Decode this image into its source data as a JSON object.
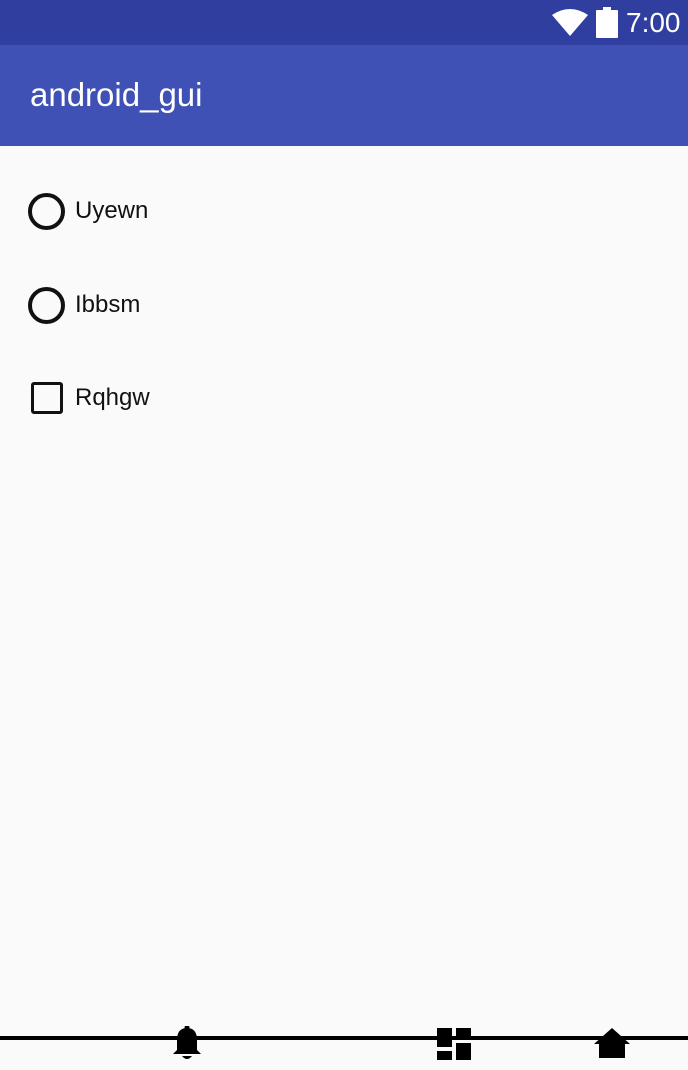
{
  "status_bar": {
    "time": "7:00",
    "icons": [
      "wifi-icon",
      "battery-icon"
    ]
  },
  "app_bar": {
    "title": "android_gui",
    "background": "#3f51b5",
    "status_background": "#303f9f"
  },
  "options": [
    {
      "type": "radio",
      "label": "Uyewn",
      "checked": false
    },
    {
      "type": "radio",
      "label": "Ibbsm",
      "checked": false
    },
    {
      "type": "checkbox",
      "label": "Rqhgw",
      "checked": false
    }
  ],
  "nav_bar": {
    "icons": [
      "bell-icon",
      "dashboard-icon",
      "home-icon"
    ]
  }
}
